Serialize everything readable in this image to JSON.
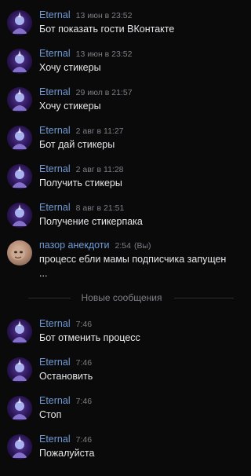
{
  "messages_before": [
    {
      "author": "Eternal",
      "time": "13 июн в 23:52",
      "text": "Бот показать гости ВКонтакте"
    },
    {
      "author": "Eternal",
      "time": "13 июн в 23:52",
      "text": "Хочу стикеры"
    },
    {
      "author": "Eternal",
      "time": "29 июл в 21:57",
      "text": "Хочу стикеры"
    },
    {
      "author": "Eternal",
      "time": "2 авг в 11:27",
      "text": "Бот дай стикеры"
    },
    {
      "author": "Eternal",
      "time": "2 авг в 11:28",
      "text": "Получить стикеры"
    },
    {
      "author": "Eternal",
      "time": "8 авг в 21:51",
      "text": "Получение стикерпака"
    },
    {
      "author": "пазор анекдоти",
      "time": "2:54",
      "role": "(Вы)",
      "text": "процесс ебли мамы подписчика запущен ..."
    }
  ],
  "divider": {
    "label": "Новые сообщения"
  },
  "messages_after": [
    {
      "author": "Eternal",
      "time": "7:46",
      "text": "Бот отменить процесс"
    },
    {
      "author": "Eternal",
      "time": "7:46",
      "text": "Остановить"
    },
    {
      "author": "Eternal",
      "time": "7:46",
      "text": "Стоп"
    },
    {
      "author": "Eternal",
      "time": "7:46",
      "text": "Пожалуйста"
    }
  ],
  "colors": {
    "background": "#0a0a0a",
    "author": "#6f9ad6",
    "meta": "#7d7f85",
    "text": "#e6e7ea"
  },
  "icons": {
    "avatar_eternal": "avatar-icon",
    "avatar_user": "avatar-icon"
  }
}
